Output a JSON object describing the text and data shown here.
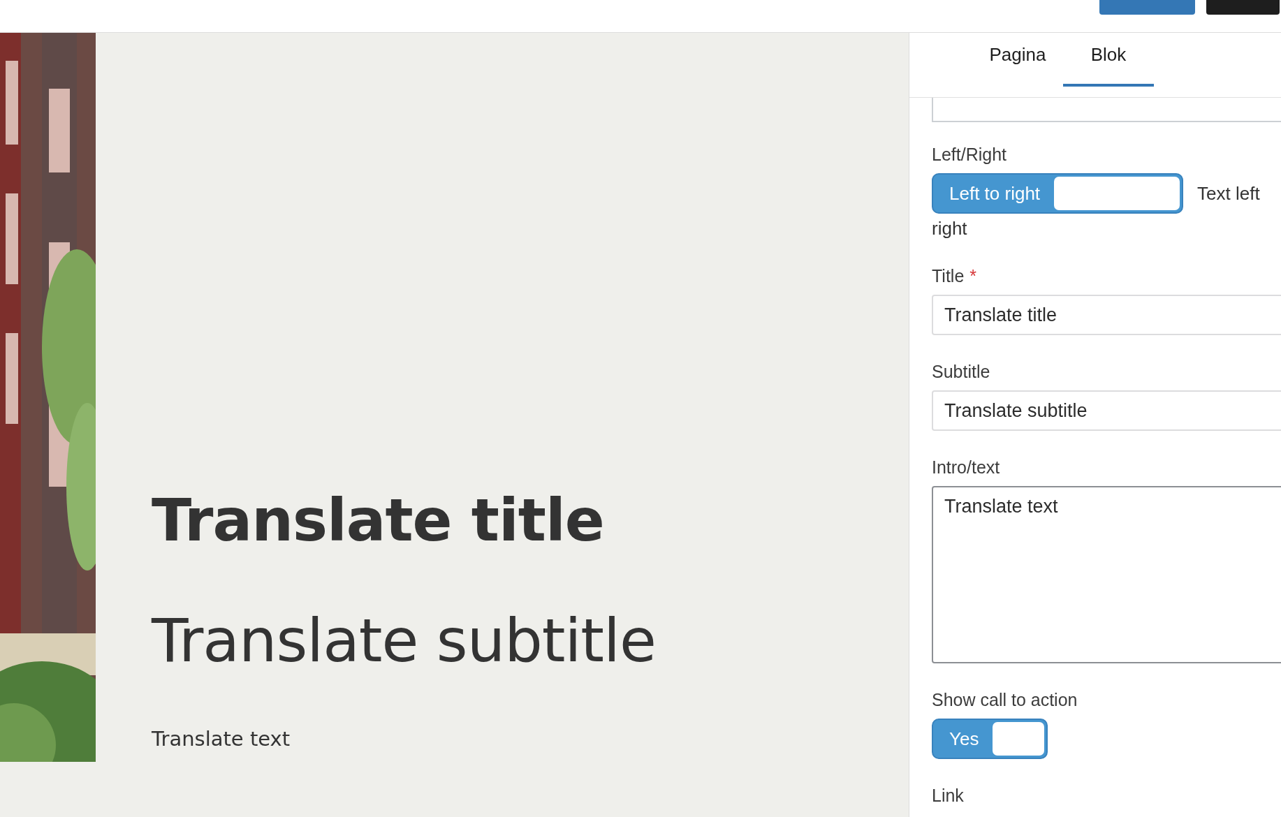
{
  "header": {
    "buttons": [
      {
        "kind": "primary"
      },
      {
        "kind": "dark"
      }
    ]
  },
  "preview": {
    "title": "Translate title",
    "subtitle": "Translate subtitle",
    "text": "Translate text"
  },
  "sidebar": {
    "tabs": [
      {
        "label": "Pagina",
        "selected": false
      },
      {
        "label": "Blok",
        "selected": true
      }
    ],
    "fields": [
      {
        "kind": "cut-input"
      },
      {
        "kind": "toggle",
        "label": "Left/Right",
        "toggle_label": "Left to right",
        "on": true,
        "description": [
          "Text left",
          "right"
        ]
      },
      {
        "kind": "input",
        "label": "Title",
        "required_mark": "*",
        "value": "Translate title"
      },
      {
        "kind": "input",
        "label": "Subtitle",
        "value": "Translate subtitle"
      },
      {
        "kind": "textarea",
        "label": "Intro/text",
        "value": "Translate text"
      },
      {
        "kind": "toggle",
        "label": "Show call to action",
        "toggle_label": "Yes",
        "on": true
      },
      {
        "kind": "label",
        "label": "Link"
      }
    ]
  }
}
